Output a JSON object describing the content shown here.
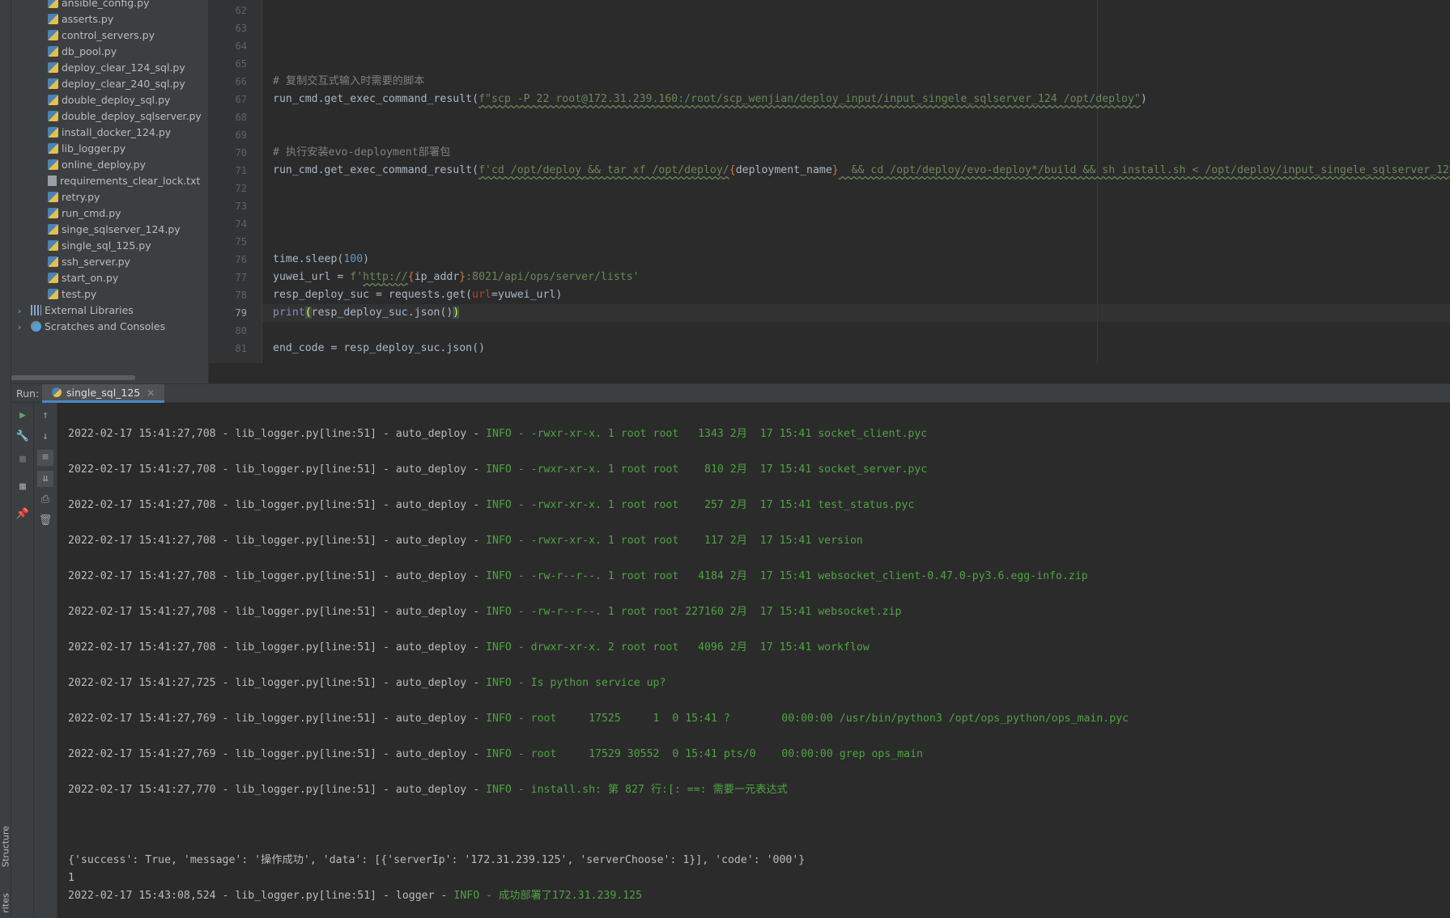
{
  "project_tree": {
    "files": [
      {
        "name": "ansible_config.py",
        "type": "py"
      },
      {
        "name": "asserts.py",
        "type": "py"
      },
      {
        "name": "control_servers.py",
        "type": "py"
      },
      {
        "name": "db_pool.py",
        "type": "py"
      },
      {
        "name": "deploy_clear_124_sql.py",
        "type": "py"
      },
      {
        "name": "deploy_clear_240_sql.py",
        "type": "py"
      },
      {
        "name": "double_deploy_sql.py",
        "type": "py"
      },
      {
        "name": "double_deploy_sqlserver.py",
        "type": "py"
      },
      {
        "name": "install_docker_124.py",
        "type": "py"
      },
      {
        "name": "lib_logger.py",
        "type": "py"
      },
      {
        "name": "online_deploy.py",
        "type": "py"
      },
      {
        "name": "requirements_clear_lock.txt",
        "type": "txt"
      },
      {
        "name": "retry.py",
        "type": "py"
      },
      {
        "name": "run_cmd.py",
        "type": "py"
      },
      {
        "name": "singe_sqlserver_124.py",
        "type": "py"
      },
      {
        "name": "single_sql_125.py",
        "type": "py"
      },
      {
        "name": "ssh_server.py",
        "type": "py"
      },
      {
        "name": "start_on.py",
        "type": "py"
      },
      {
        "name": "test.py",
        "type": "py"
      }
    ],
    "external_libraries": "External Libraries",
    "scratches": "Scratches and Consoles"
  },
  "side_tabs": {
    "structure": "Structure",
    "favorites": "rites"
  },
  "editor": {
    "line_numbers": [
      "62",
      "63",
      "64",
      "65",
      "66",
      "67",
      "68",
      "69",
      "70",
      "71",
      "72",
      "73",
      "74",
      "75",
      "76",
      "77",
      "78",
      "79",
      "80",
      "81"
    ],
    "current_line": "79",
    "lines": {
      "l66": "# 复制交互式输入时需要的脚本",
      "l67_a": "run_cmd.get_exec_command_result(",
      "l67_b": "f\"scp -P 22 root@172.31.239.160:/root/scp_wenjian/deploy_input/input_singele_sqlserver_124 /opt/deploy\"",
      "l67_c": ")",
      "l70": "# 执行安装evo-deployment部署包",
      "l71_a": "run_cmd.get_exec_command_result(",
      "l71_b": "f'cd /opt/deploy && tar xf /opt/deploy/",
      "l71_c": "{",
      "l71_d": "deployment_name",
      "l71_e": "}",
      "l71_f": "  && cd /opt/deploy/evo-deploy*/build && sh install.sh < /opt/deploy/input_singele_sqlserver_12",
      "l76_a": "time.sleep(",
      "l76_b": "100",
      "l76_c": ")",
      "l77_a": "yuwei_url = ",
      "l77_b": "f'",
      "l77_c": "http://",
      "l77_d": "{",
      "l77_e": "ip_addr",
      "l77_f": "}",
      "l77_g": ":8021/api/ops/server/lists'",
      "l78_a": "resp_deploy_suc = requests.get(",
      "l78_b": "url",
      "l78_c": "=yuwei_url)",
      "l79_a": "print",
      "l79_b": "(",
      "l79_c": "resp_deploy_suc.json()",
      "l79_d": ")",
      "l81": "end_code = resp_deploy_suc.json()"
    }
  },
  "run_panel": {
    "label": "Run:",
    "tab_name": "single_sql_125",
    "console_lines": [
      {
        "prefix": "2022-02-17 15:41:27,708 - lib_logger.py[line:51] - auto_deploy - ",
        "info": "INFO - -rwxr-xr-x. 1 root root   1343 2月  17 15:41 socket_client.pyc"
      },
      {
        "prefix": "2022-02-17 15:41:27,708 - lib_logger.py[line:51] - auto_deploy - ",
        "info": "INFO - -rwxr-xr-x. 1 root root    810 2月  17 15:41 socket_server.pyc"
      },
      {
        "prefix": "2022-02-17 15:41:27,708 - lib_logger.py[line:51] - auto_deploy - ",
        "info": "INFO - -rwxr-xr-x. 1 root root    257 2月  17 15:41 test_status.pyc"
      },
      {
        "prefix": "2022-02-17 15:41:27,708 - lib_logger.py[line:51] - auto_deploy - ",
        "info": "INFO - -rwxr-xr-x. 1 root root    117 2月  17 15:41 version"
      },
      {
        "prefix": "2022-02-17 15:41:27,708 - lib_logger.py[line:51] - auto_deploy - ",
        "info": "INFO - -rw-r--r--. 1 root root   4184 2月  17 15:41 websocket_client-0.47.0-py3.6.egg-info.zip"
      },
      {
        "prefix": "2022-02-17 15:41:27,708 - lib_logger.py[line:51] - auto_deploy - ",
        "info": "INFO - -rw-r--r--. 1 root root 227160 2月  17 15:41 websocket.zip"
      },
      {
        "prefix": "2022-02-17 15:41:27,708 - lib_logger.py[line:51] - auto_deploy - ",
        "info": "INFO - drwxr-xr-x. 2 root root   4096 2月  17 15:41 workflow"
      },
      {
        "prefix": "2022-02-17 15:41:27,725 - lib_logger.py[line:51] - auto_deploy - ",
        "info": "INFO - Is python service up?"
      },
      {
        "prefix": "2022-02-17 15:41:27,769 - lib_logger.py[line:51] - auto_deploy - ",
        "info": "INFO - root     17525     1  0 15:41 ?        00:00:00 /usr/bin/python3 /opt/ops_python/ops_main.pyc"
      },
      {
        "prefix": "2022-02-17 15:41:27,769 - lib_logger.py[line:51] - auto_deploy - ",
        "info": "INFO - root     17529 30552  0 15:41 pts/0    00:00:00 grep ops_main"
      },
      {
        "prefix": "2022-02-17 15:41:27,770 - lib_logger.py[line:51] - auto_deploy - ",
        "info": "INFO - install.sh: 第 827 行:[: ==: 需要一元表达式"
      }
    ],
    "result_line": "{'success': True, 'message': '操作成功', 'data': [{'serverIp': '172.31.239.125', 'serverChoose': 1}], 'code': '000'}",
    "one_line": "1",
    "final_line": {
      "prefix": "2022-02-17 15:43:08,524 - lib_logger.py[line:51] - logger - ",
      "info": "INFO - 成功部署了172.31.239.125"
    }
  },
  "icons": {
    "run": "play-icon",
    "up": "arrow-up-icon",
    "down": "arrow-down-icon",
    "wrench": "wrench-icon",
    "stop": "stop-icon",
    "wrap": "soft-wrap-icon",
    "scroll_end": "scroll-to-end-icon",
    "layout": "layout-icon",
    "print": "print-icon",
    "pin": "pin-icon",
    "trash": "trash-icon"
  },
  "colors": {
    "info_green": "#4fa342",
    "string_green": "#6a8759",
    "comment_gray": "#808080",
    "number_blue": "#6897bb"
  }
}
